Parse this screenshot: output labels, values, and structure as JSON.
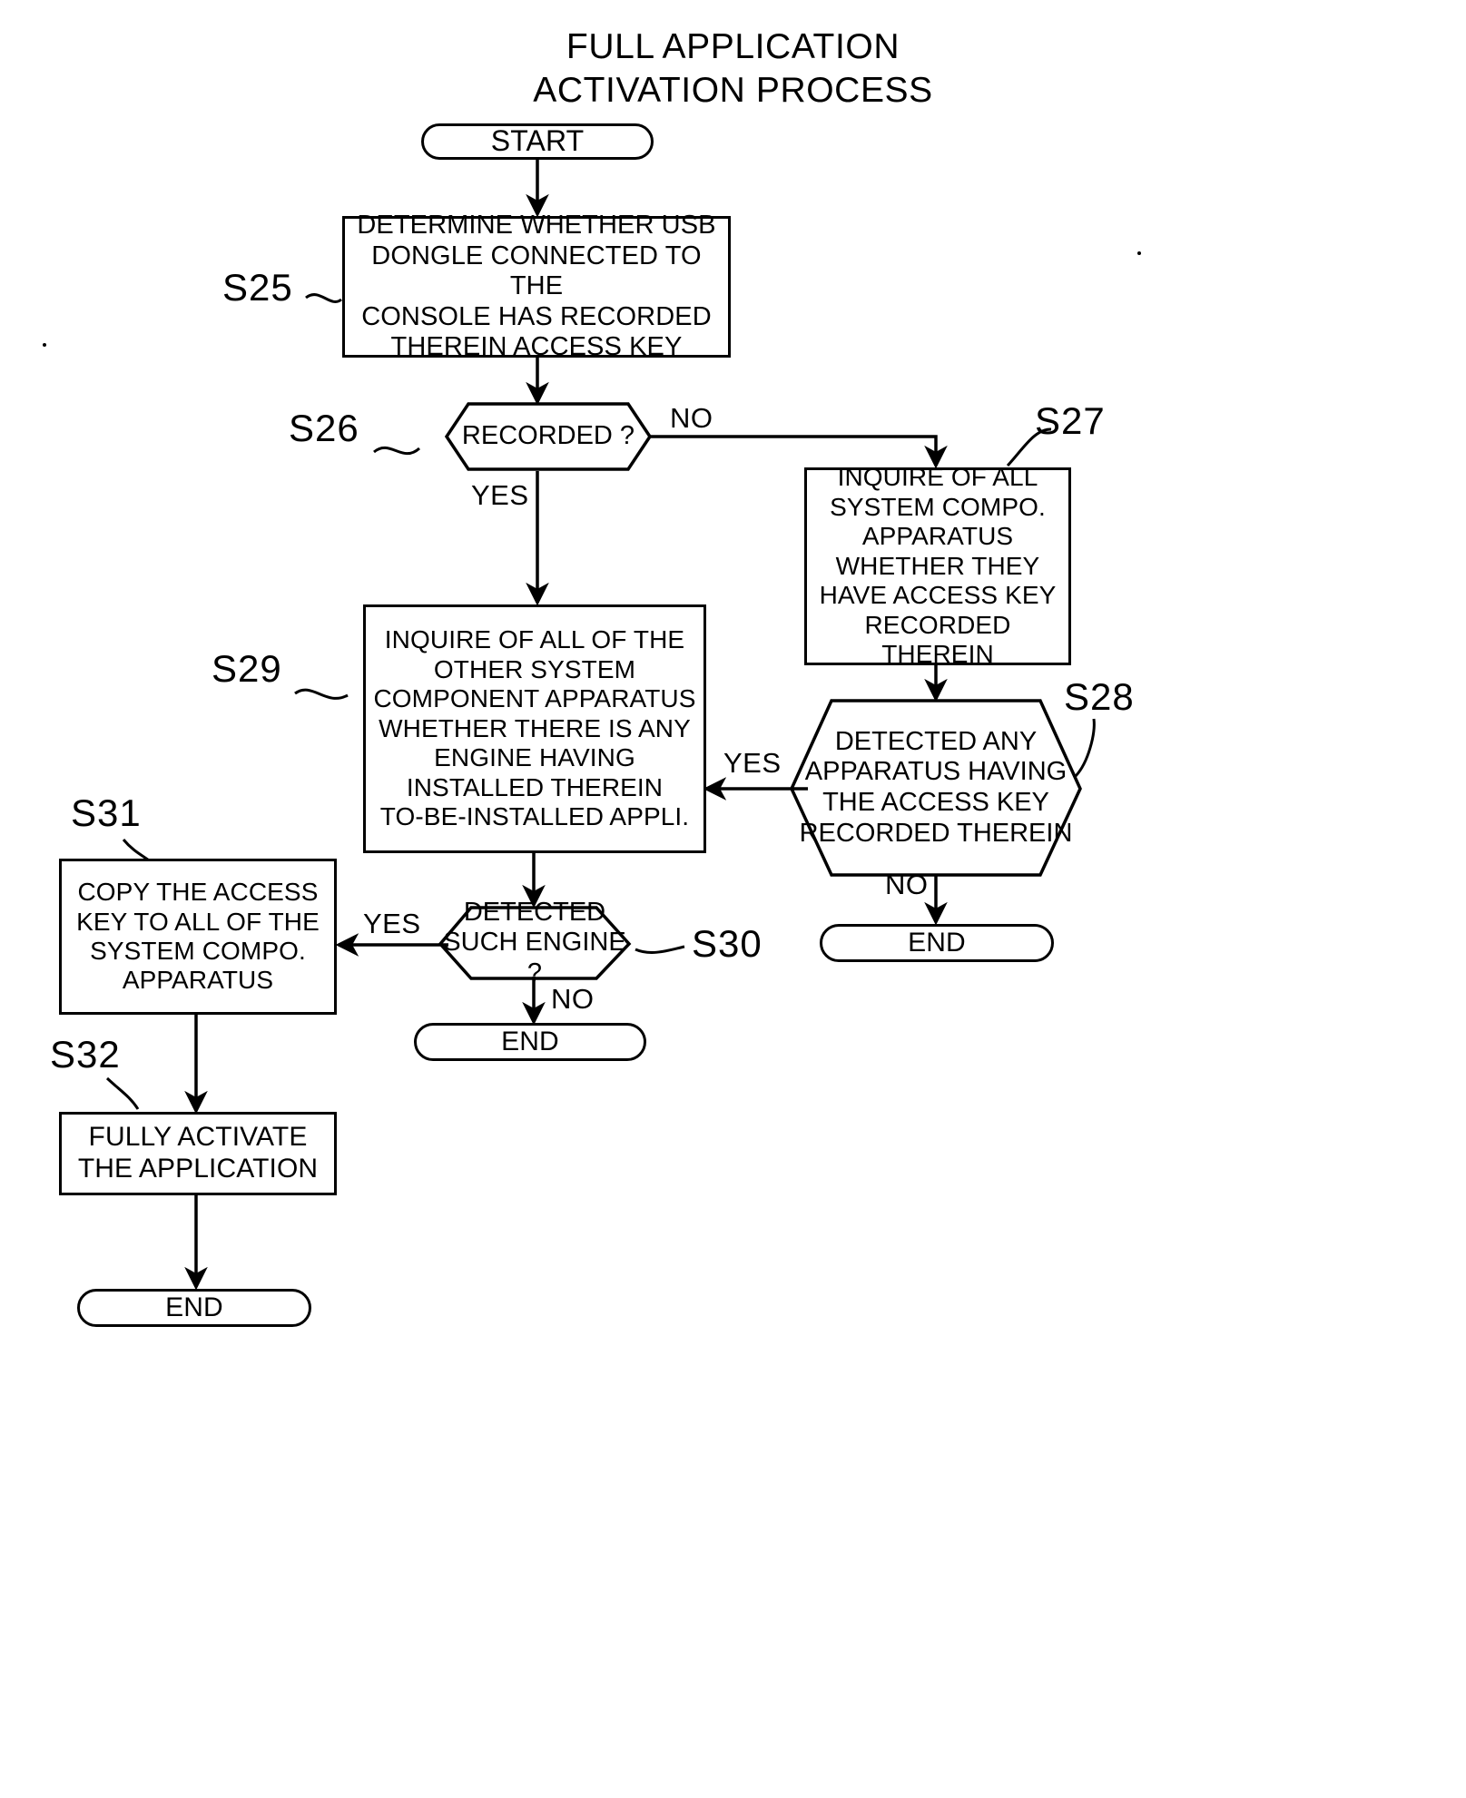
{
  "diagram": {
    "title_line1": "FULL APPLICATION",
    "title_line2": "ACTIVATION PROCESS",
    "type": "flowchart",
    "nodes": {
      "start": {
        "label": "START",
        "shape": "terminal"
      },
      "s25": {
        "step": "S25",
        "shape": "process",
        "text": "DETERMINE WHETHER USB DONGLE CONNECTED TO THE CONSOLE HAS RECORDED THEREIN ACCESS KEY",
        "lines": [
          "DETERMINE WHETHER USB",
          "DONGLE CONNECTED TO THE",
          "CONSOLE HAS RECORDED",
          "THEREIN ACCESS KEY"
        ]
      },
      "s26": {
        "step": "S26",
        "shape": "decision",
        "text": "RECORDED ?",
        "lines": [
          "RECORDED ?"
        ]
      },
      "s27": {
        "step": "S27",
        "shape": "process",
        "text": "INQUIRE OF ALL SYSTEM COMPO. APPARATUS WHETHER THEY HAVE ACCESS KEY RECORDED THEREIN",
        "lines": [
          "INQUIRE OF ALL",
          "SYSTEM COMPO.",
          "APPARATUS",
          "WHETHER THEY",
          "HAVE ACCESS KEY",
          "RECORDED THEREIN"
        ]
      },
      "s28": {
        "step": "S28",
        "shape": "decision",
        "text": "DETECTED ANY APPARATUS HAVING THE ACCESS KEY RECORDED THEREIN",
        "lines": [
          "DETECTED ANY",
          "APPARATUS HAVING",
          "THE ACCESS KEY",
          "RECORDED THEREIN"
        ]
      },
      "s29": {
        "step": "S29",
        "shape": "process",
        "text": "INQUIRE OF ALL OF THE OTHER SYSTEM COMPONENT APPARATUS WHETHER THERE IS ANY ENGINE HAVING INSTALLED THEREIN TO-BE-INSTALLED APPLI.",
        "lines": [
          "INQUIRE OF ALL OF THE",
          "OTHER SYSTEM",
          "COMPONENT APPARATUS",
          "WHETHER THERE IS ANY",
          "ENGINE HAVING",
          "INSTALLED THEREIN",
          "TO-BE-INSTALLED APPLI."
        ]
      },
      "s30": {
        "step": "S30",
        "shape": "decision",
        "text": "DETECTED SUCH ENGINE ?",
        "lines": [
          "DETECTED",
          "SUCH ENGINE ?"
        ]
      },
      "s31": {
        "step": "S31",
        "shape": "process",
        "text": "COPY THE ACCESS KEY TO ALL OF THE SYSTEM COMPO. APPARATUS",
        "lines": [
          "COPY THE ACCESS",
          "KEY TO ALL OF THE",
          "SYSTEM COMPO.",
          "APPARATUS"
        ]
      },
      "s32": {
        "step": "S32",
        "shape": "process",
        "text": "FULLY ACTIVATE THE APPLICATION",
        "lines": [
          "FULLY ACTIVATE",
          "THE APPLICATION"
        ]
      },
      "end_s28": {
        "label": "END",
        "shape": "terminal"
      },
      "end_s30": {
        "label": "END",
        "shape": "terminal"
      },
      "end_s32": {
        "label": "END",
        "shape": "terminal"
      }
    },
    "edge_labels": {
      "s26_no": "NO",
      "s26_yes": "YES",
      "s28_yes": "YES",
      "s28_no": "NO",
      "s30_yes": "YES",
      "s30_no": "NO"
    },
    "colors": {
      "stroke": "#000000",
      "background": "#ffffff",
      "text": "#000000"
    }
  }
}
